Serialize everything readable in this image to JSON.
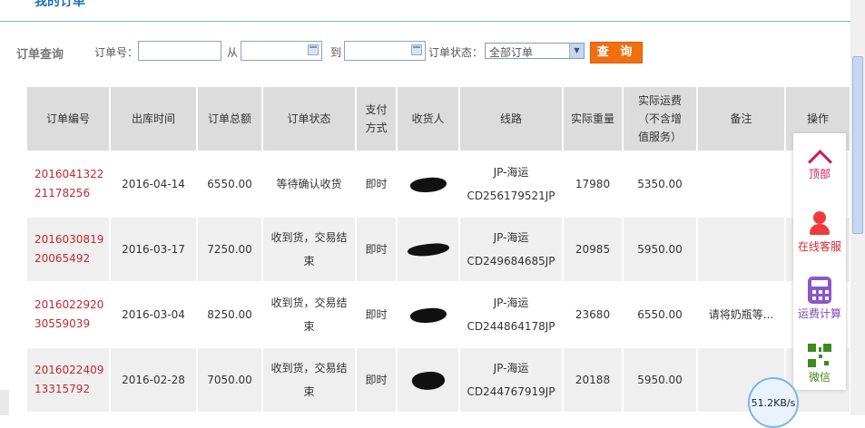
{
  "page": {
    "title": "我的订单"
  },
  "search": {
    "section_label": "订单查询",
    "order_no_label": "订单号：",
    "order_no_value": "",
    "from_label": "从",
    "from_value": "",
    "to_label": "到",
    "to_value": "",
    "status_label": "订单状态：",
    "status_selected": "全部订单",
    "query_button": "查 询",
    "calendar_icon": "calendar-icon"
  },
  "table": {
    "headers": [
      "订单编号",
      "出库时间",
      "订单总额",
      "订单状态",
      "支付方式",
      "收货人",
      "线路",
      "实际重量",
      "实际运费（不含增值服务）",
      "备注",
      "操作"
    ],
    "header_display": {
      "pay": [
        "支付",
        "方式"
      ],
      "freight": [
        "实际运费",
        "（不含增",
        "值服务）"
      ]
    },
    "rows": [
      {
        "order_no": [
          "2016041322",
          "21178256"
        ],
        "ship_date": "2016-04-14",
        "total": "6550.00",
        "status": [
          "等待确认收货"
        ],
        "pay": "即时",
        "route": [
          "JP-海运",
          "CD256179521JP"
        ],
        "weight": "17980",
        "freight": "5350.00",
        "note": ""
      },
      {
        "order_no": [
          "2016030819",
          "20065492"
        ],
        "ship_date": "2016-03-17",
        "total": "7250.00",
        "status": [
          "收到货，交易结",
          "束"
        ],
        "pay": "即时",
        "route": [
          "JP-海运",
          "CD249684685JP"
        ],
        "weight": "20985",
        "freight": "5950.00",
        "note": ""
      },
      {
        "order_no": [
          "2016022920",
          "30559039"
        ],
        "ship_date": "2016-03-04",
        "total": "8250.00",
        "status": [
          "收到货，交易结",
          "束"
        ],
        "pay": "即时",
        "route": [
          "JP-海运",
          "CD244864178JP"
        ],
        "weight": "23680",
        "freight": "6550.00",
        "note": "请将奶瓶等..."
      },
      {
        "order_no": [
          "2016022409",
          "13315792"
        ],
        "ship_date": "2016-02-28",
        "total": "7050.00",
        "status": [
          "收到货，交易结",
          "束"
        ],
        "pay": "即时",
        "route": [
          "JP-海运",
          "CD244767919JP"
        ],
        "weight": "20188",
        "freight": "5950.00",
        "note": ""
      }
    ]
  },
  "float_panel": {
    "top": "顶部",
    "service": "在线客服",
    "calc": "运费计算",
    "wechat": "微信"
  },
  "speed": "51.2KB/s",
  "colors": {
    "accent": "#f06f11",
    "order_link": "#c0282d",
    "title": "#1f6fb6"
  }
}
